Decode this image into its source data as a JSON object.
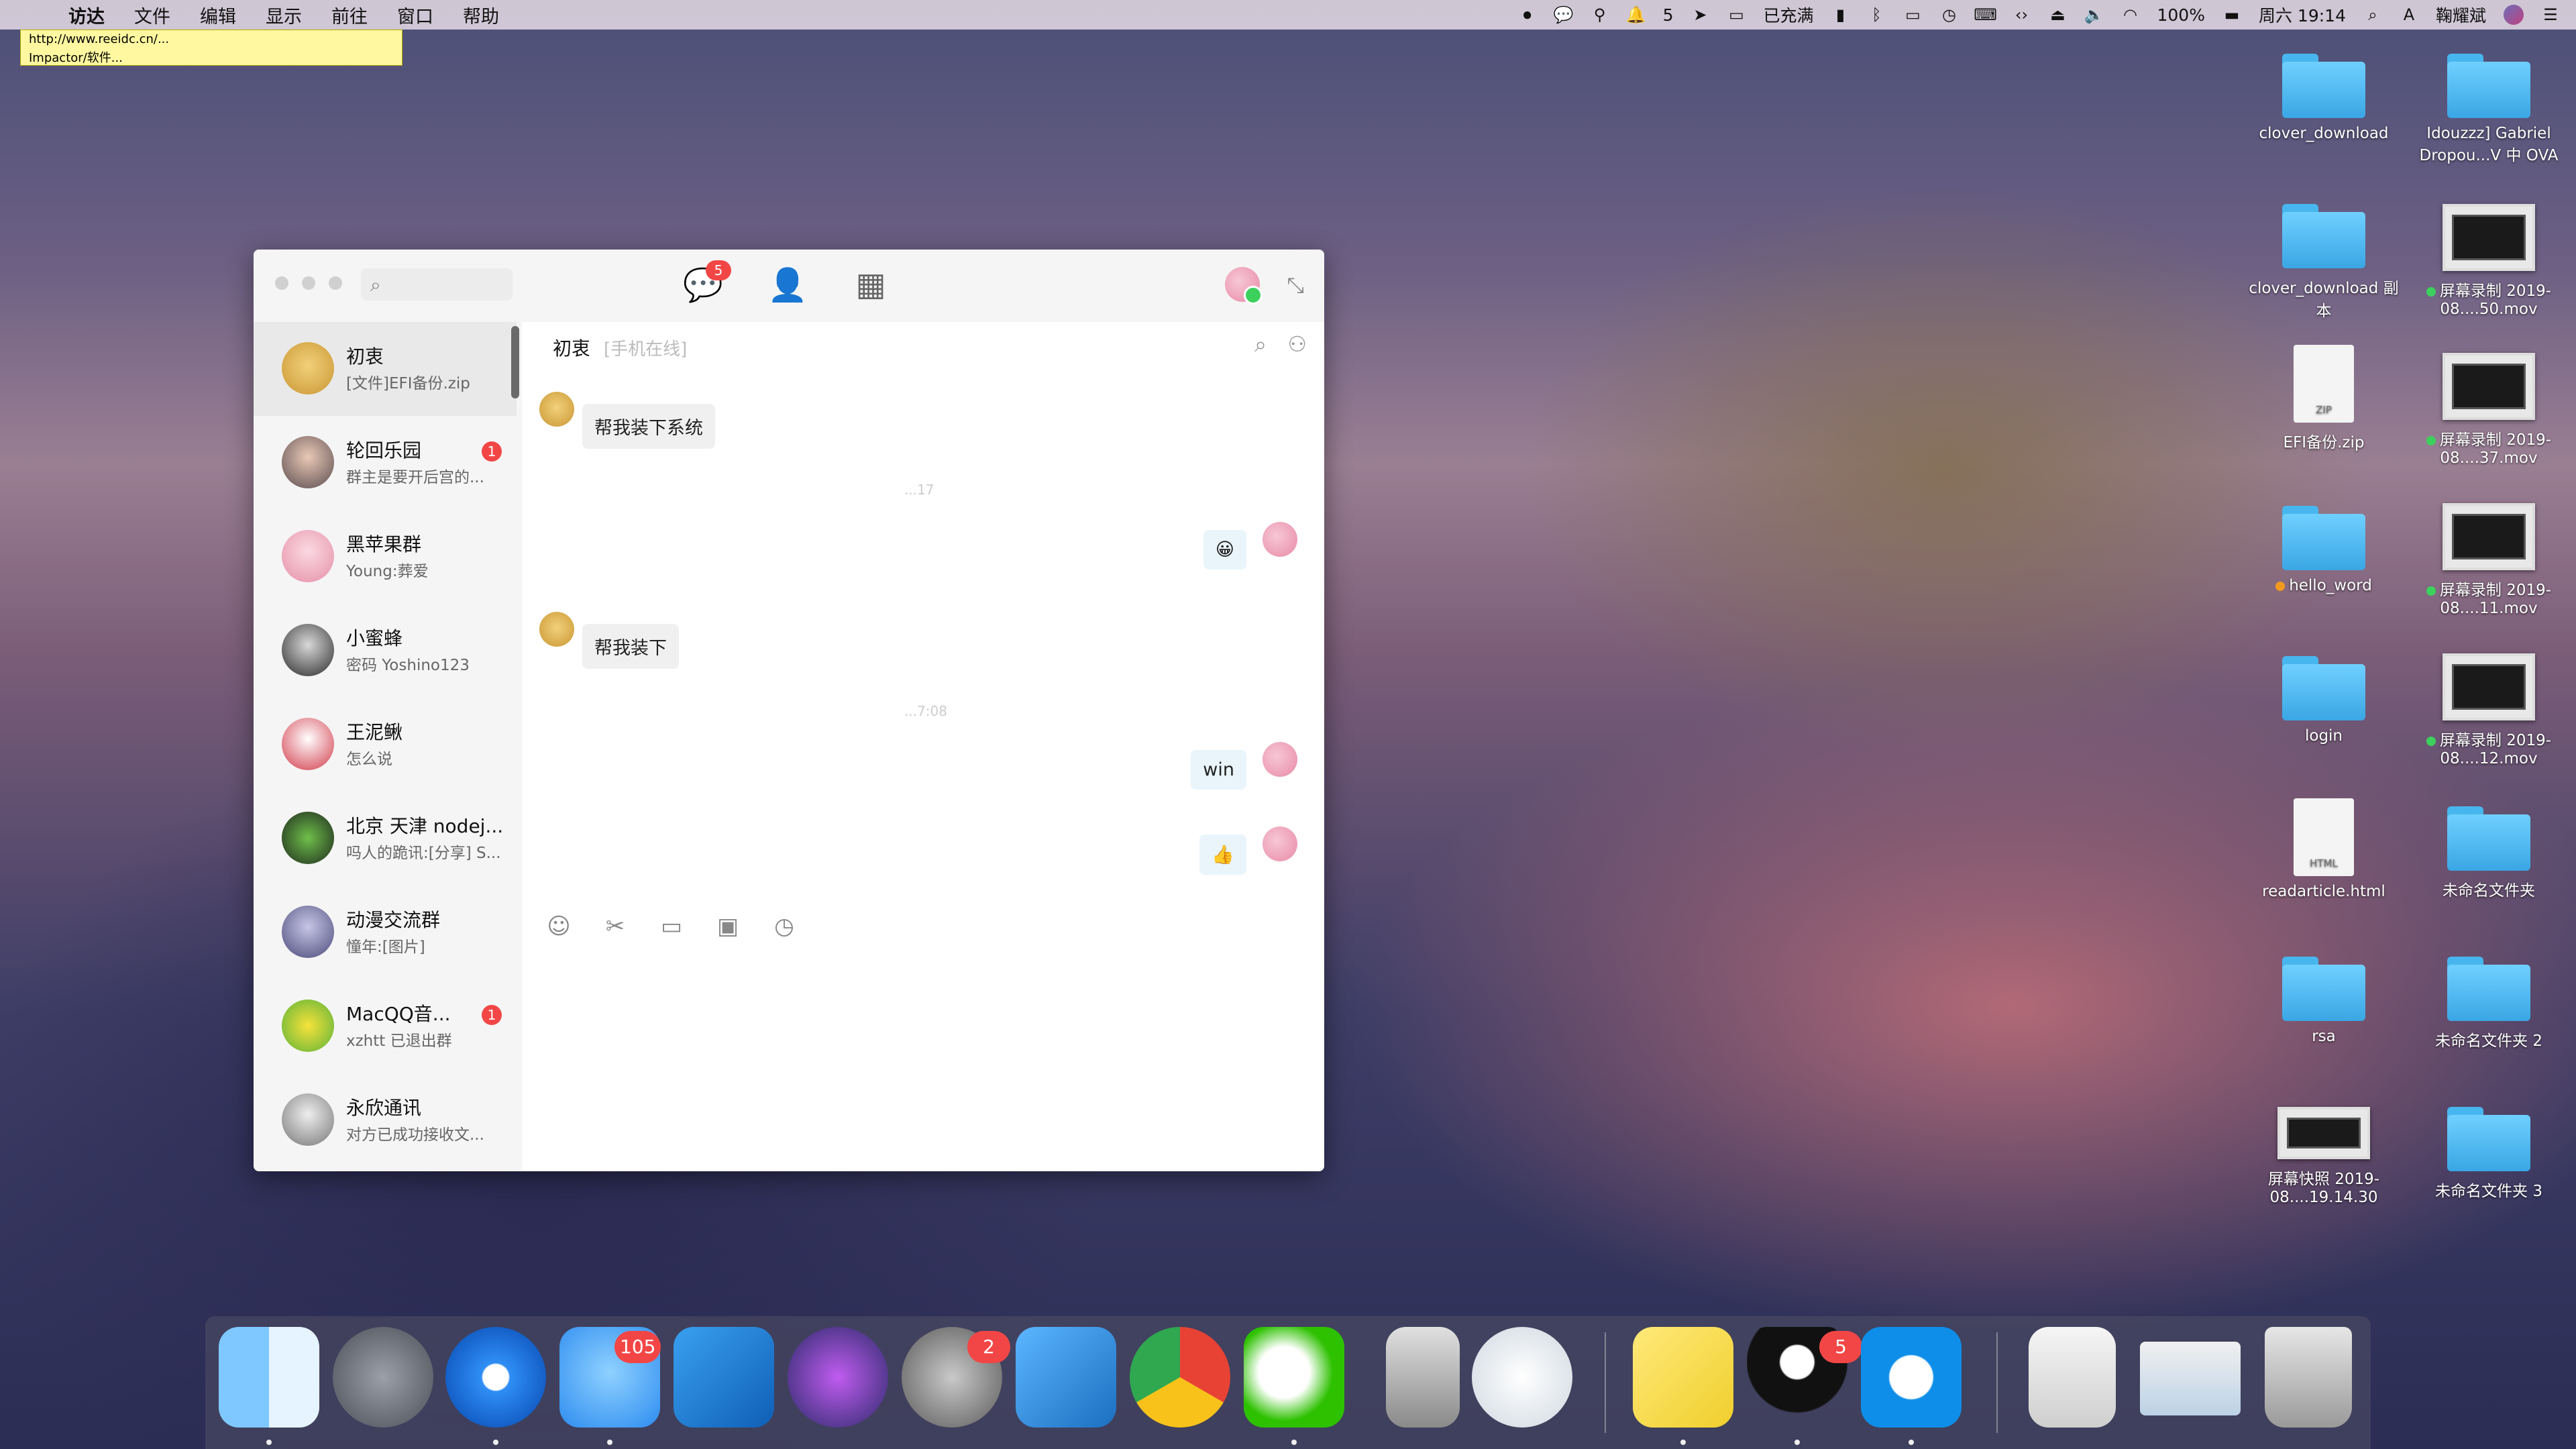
{
  "menubar": {
    "items": [
      "访达",
      "文件",
      "编辑",
      "显示",
      "前往",
      "窗口",
      "帮助"
    ],
    "status": {
      "badge_count": "5",
      "charging": "已充满",
      "battery": "100%",
      "clock": "周六 19:14",
      "user": "鞠耀斌"
    }
  },
  "url_tooltip": {
    "line1": "http://www.reeidc.cn/...",
    "line2": "Impactor/软件..."
  },
  "desktop_icons": [
    {
      "label": "clover_download",
      "kind": "folder"
    },
    {
      "label": "Idouzzz] Gabriel Dropou...V 中 OVA",
      "kind": "folder"
    },
    {
      "label": "clover_download 副本",
      "kind": "folder"
    },
    {
      "label": "屏幕录制 2019-08....50.mov",
      "kind": "movie"
    },
    {
      "label": "EFI备份.zip",
      "kind": "zip"
    },
    {
      "label": "屏幕录制 2019-08....37.mov",
      "kind": "movie"
    },
    {
      "label": "hello_word",
      "kind": "folder"
    },
    {
      "label": "屏幕录制 2019-08....11.mov",
      "kind": "movie"
    },
    {
      "label": "login",
      "kind": "folder"
    },
    {
      "label": "屏幕录制 2019-08....12.mov",
      "kind": "movie"
    },
    {
      "label": "readarticle.html",
      "kind": "html"
    },
    {
      "label": "未命名文件夹",
      "kind": "folder"
    },
    {
      "label": "rsa",
      "kind": "folder"
    },
    {
      "label": "未命名文件夹 2",
      "kind": "folder"
    },
    {
      "label": "屏幕快照 2019-08....19.14.30",
      "kind": "screenshot"
    },
    {
      "label": "未命名文件夹 3",
      "kind": "folder"
    }
  ],
  "qq": {
    "message_badge": "5",
    "chats": [
      {
        "name": "初衷",
        "preview": "[文件]EFI备份.zip",
        "unread": ""
      },
      {
        "name": "轮回乐园",
        "preview": "群主是要开后宫的...",
        "unread": "1"
      },
      {
        "name": "黑苹果群",
        "preview": "Young:葬爱",
        "unread": ""
      },
      {
        "name": "小蜜蜂",
        "preview": "密码 Yoshino123",
        "unread": ""
      },
      {
        "name": "王泥鳅",
        "preview": "怎么说",
        "unread": ""
      },
      {
        "name": "北京 天津 nodej...",
        "preview": "吗人的跪讯:[分享] S...",
        "unread": ""
      },
      {
        "name": "动漫交流群",
        "preview": "憧年:[图片]",
        "unread": ""
      },
      {
        "name": "MacQQ音...",
        "preview": "xzhtt 已退出群",
        "unread": "1"
      },
      {
        "name": "永欣通讯",
        "preview": "对方已成功接收文...",
        "unread": ""
      }
    ],
    "conversation": {
      "title": "初衷",
      "subtitle": "[手机在线]",
      "messages": [
        {
          "from": "them",
          "text": "帮我装下系统"
        },
        {
          "from": "time",
          "text": "...17"
        },
        {
          "from": "me",
          "text": "😀"
        },
        {
          "from": "them",
          "text": "帮我装下"
        },
        {
          "from": "time",
          "text": "...7:08"
        },
        {
          "from": "me",
          "text": "win"
        },
        {
          "from": "me",
          "text": "👍"
        }
      ]
    }
  },
  "dock": {
    "badges": {
      "messages": "105",
      "settings": "2",
      "qq": "5"
    },
    "apps": [
      "finder",
      "launchpad",
      "safari",
      "messages",
      "vscode",
      "siri",
      "system-preferences",
      "migration",
      "chrome",
      "wechat",
      "utility",
      "sequel",
      "stickies",
      "qq",
      "teamviewer",
      "docx",
      "preview",
      "trash"
    ]
  }
}
